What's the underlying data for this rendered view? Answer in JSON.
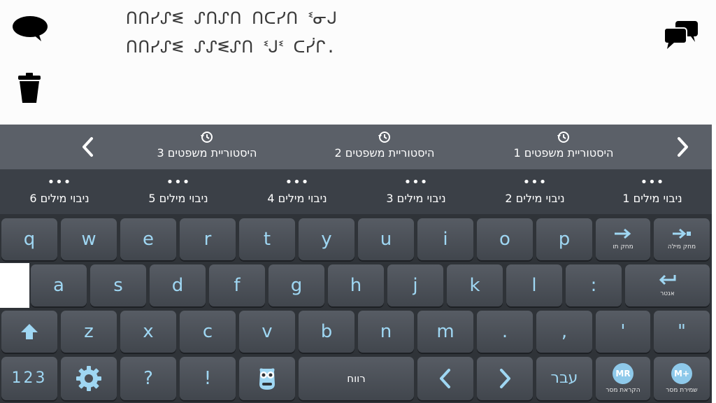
{
  "text_area": {
    "line1": "ᑎᑎᓯᔑᓬ ᔑᑎᔑᑎ ᑎᑕᓯᑎ ᓫᓂᒍ",
    "line2": "ᑎᑎᓯᔑᓬ ᔑᔑᓬᔑᑎ ᓫᒍᓫ ᑕᓰᒋ."
  },
  "icons": {
    "speak": "speech-bubble-icon",
    "clear": "trash-icon",
    "chat": "chat-bubbles-icon"
  },
  "history": {
    "items": [
      {
        "label": "היסטוריית משפטים 3"
      },
      {
        "label": "היסטוריית משפטים 2"
      },
      {
        "label": "היסטוריית משפטים 1"
      }
    ]
  },
  "levels": {
    "dots": "•••",
    "items": [
      {
        "label": "ניבוי מילים 6"
      },
      {
        "label": "ניבוי מילים 5"
      },
      {
        "label": "ניבוי מילים 4"
      },
      {
        "label": "ניבוי מילים 3"
      },
      {
        "label": "ניבוי מילים 2"
      },
      {
        "label": "ניבוי מילים 1"
      }
    ]
  },
  "keyboard": {
    "row1": [
      "q",
      "w",
      "e",
      "r",
      "t",
      "y",
      "u",
      "i",
      "o",
      "p"
    ],
    "row1_special": [
      {
        "label": "מחק תו",
        "icon": "arrow-right-icon"
      },
      {
        "label": "מחק מילה",
        "icon": "arrow-right-bar-icon"
      }
    ],
    "row2": [
      "a",
      "s",
      "d",
      "f",
      "g",
      "h",
      "j",
      "k",
      "l",
      ":"
    ],
    "enter": {
      "label": "אנטר",
      "icon": "return-arrow-icon"
    },
    "shift_icon": "shift-arrow-icon",
    "row3": [
      "z",
      "x",
      "c",
      "v",
      "b",
      "n",
      "m",
      ".",
      ",",
      "'",
      "\""
    ],
    "row4": {
      "numbers": "123",
      "settings_icon": "gear-icon",
      "question": "?",
      "exclaim": "!",
      "mascot_icon": "owl-mascot-icon",
      "space": "רווח",
      "lang": "עבר",
      "read_msg": {
        "badge": "MR",
        "label": "הקראת מסר"
      },
      "save_msg": {
        "badge": "M+",
        "label": "שמירת מסר"
      }
    }
  },
  "colors": {
    "history_bar": "#5b6068",
    "level_bar": "#3b4047",
    "keyboard_bg": "#2f3338",
    "key_text": "#9fd7f3"
  }
}
